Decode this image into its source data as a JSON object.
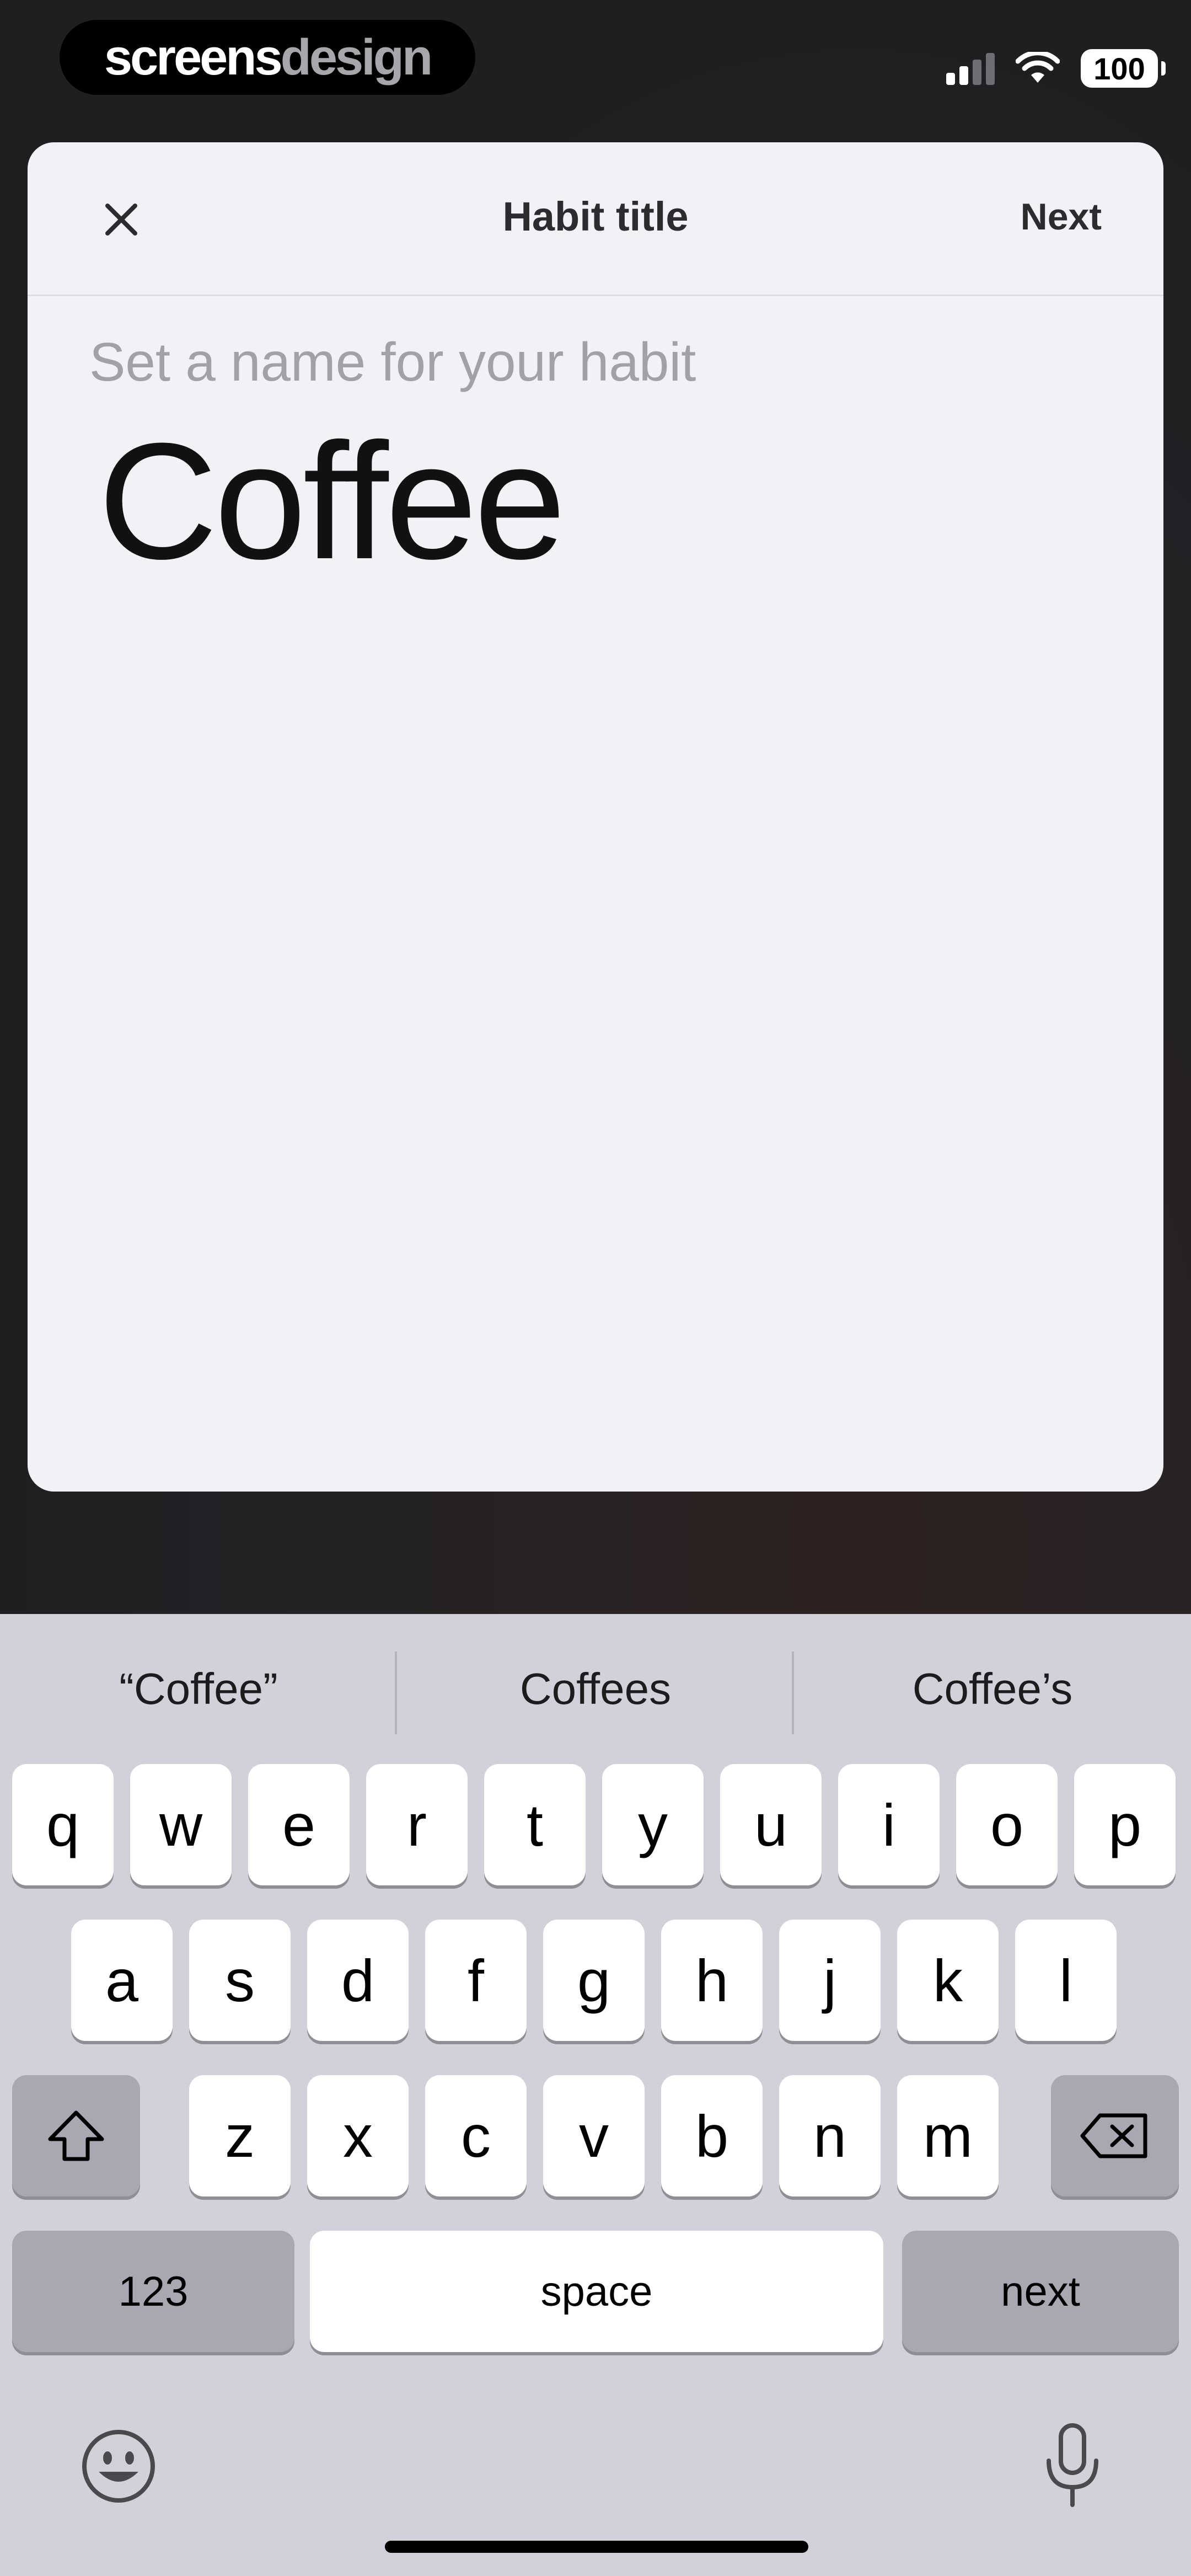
{
  "status_bar": {
    "logo_bold": "screens",
    "logo_light": "design",
    "battery": "100"
  },
  "sheet": {
    "title": "Habit title",
    "next_label": "Next",
    "close_icon": "close-icon",
    "prompt": "Set a name for your habit",
    "habit_name": "Coffee"
  },
  "keyboard": {
    "suggestions": [
      "“Coffee”",
      "Coffees",
      "Coffee’s"
    ],
    "row1": [
      "q",
      "w",
      "e",
      "r",
      "t",
      "y",
      "u",
      "i",
      "o",
      "p"
    ],
    "row2": [
      "a",
      "s",
      "d",
      "f",
      "g",
      "h",
      "j",
      "k",
      "l"
    ],
    "row3": [
      "z",
      "x",
      "c",
      "v",
      "b",
      "n",
      "m"
    ],
    "numbers_label": "123",
    "space_label": "space",
    "return_label": "next",
    "icons": {
      "shift": "shift-icon",
      "delete": "delete-icon",
      "emoji": "emoji-icon",
      "mic": "microphone-icon"
    }
  },
  "colors": {
    "sheet_bg": "#f2f1f6",
    "keyboard_bg": "#d1d1d9",
    "background": "#222125"
  }
}
